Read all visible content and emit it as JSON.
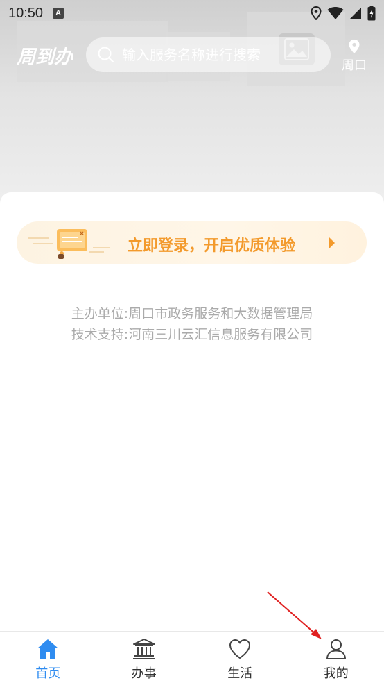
{
  "status_bar": {
    "time": "10:50",
    "notification_badge": "A"
  },
  "header": {
    "logo_text": "周到办",
    "search_placeholder": "输入服务名称进行搜索",
    "location_label": "周口"
  },
  "banner": {
    "text": "立即登录，开启优质体验"
  },
  "footer": {
    "organizer": "主办单位:周口市政务服务和大数据管理局",
    "support": "技术支持:河南三川云汇信息服务有限公司"
  },
  "tabs": [
    {
      "label": "首页",
      "icon": "home-icon",
      "active": true
    },
    {
      "label": "办事",
      "icon": "government-building-icon",
      "active": false
    },
    {
      "label": "生活",
      "icon": "heart-icon",
      "active": false
    },
    {
      "label": "我的",
      "icon": "user-icon",
      "active": false
    }
  ],
  "colors": {
    "accent": "#2f8cf0",
    "banner_text": "#f39a2c",
    "footer_text": "#aaaaaa",
    "annotation_arrow": "#e02020"
  }
}
